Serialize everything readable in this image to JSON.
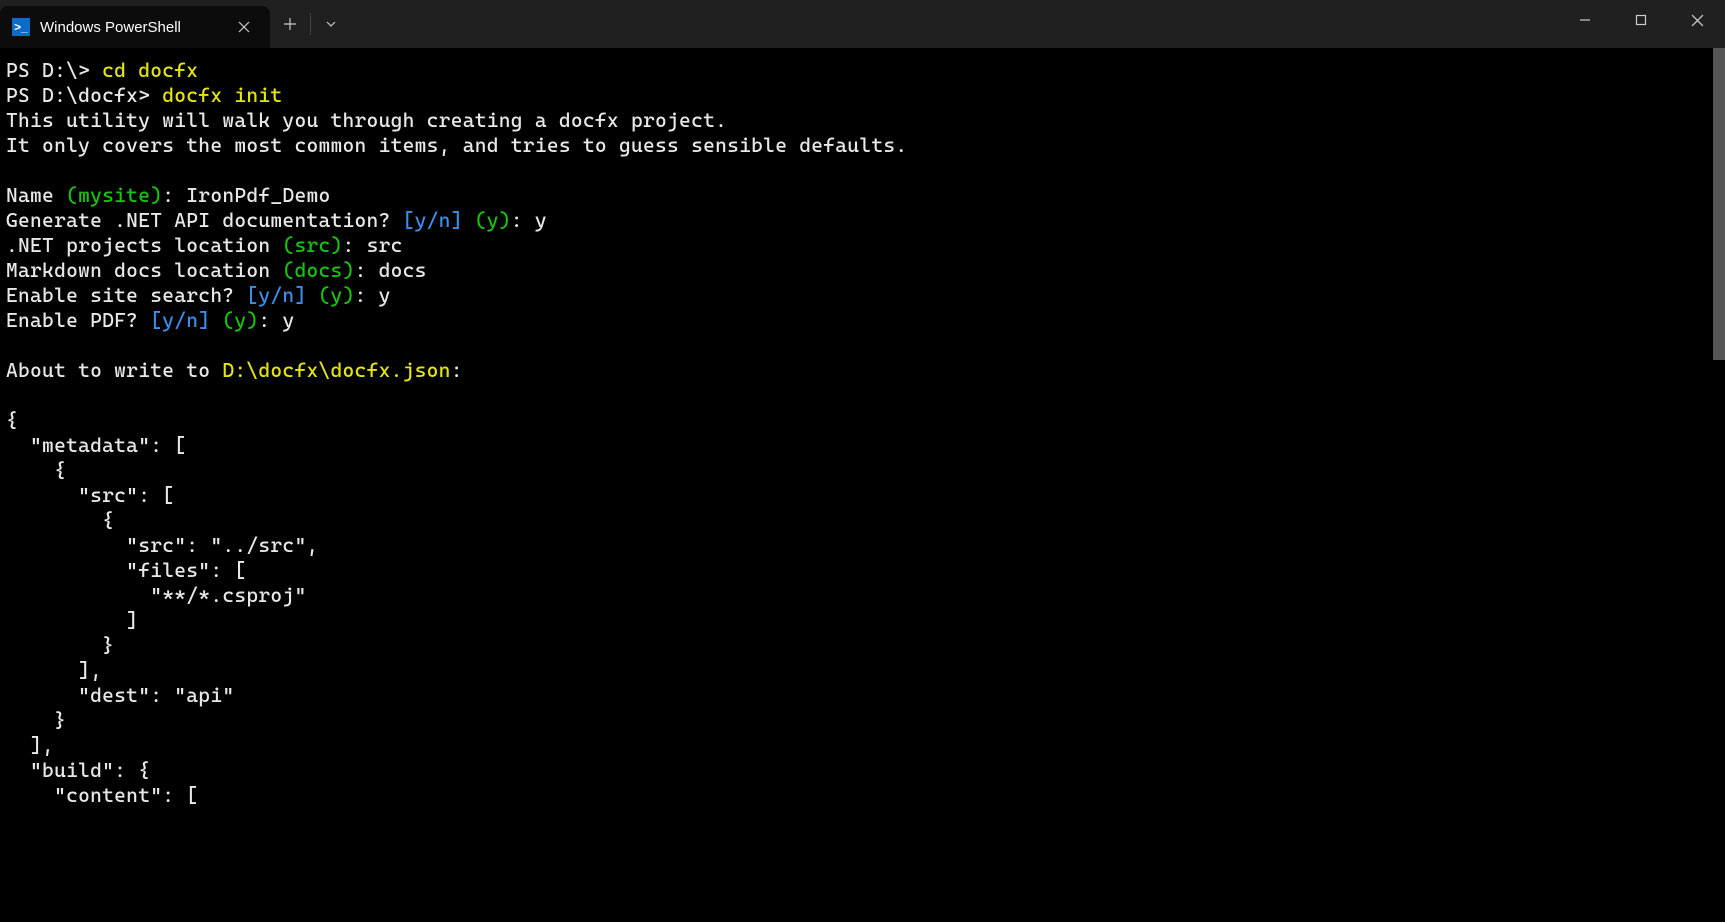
{
  "tab": {
    "title": "Windows PowerShell"
  },
  "terminal": {
    "line1_prompt": "PS D:\\> ",
    "line1_cmd": "cd docfx",
    "line2_prompt": "PS D:\\docfx> ",
    "line2_cmd": "docfx init",
    "line3": "This utility will walk you through creating a docfx project.",
    "line4": "It only covers the most common items, and tries to guess sensible defaults.",
    "line5_a": "Name ",
    "line5_b": "(mysite)",
    "line5_c": ": IronPdf_Demo",
    "line6_a": "Generate .NET API documentation? ",
    "line6_b": "[y/n]",
    "line6_c": " (y)",
    "line6_d": ": y",
    "line7_a": ".NET projects location ",
    "line7_b": "(src)",
    "line7_c": ": src",
    "line8_a": "Markdown docs location ",
    "line8_b": "(docs)",
    "line8_c": ": docs",
    "line9_a": "Enable site search? ",
    "line9_b": "[y/n]",
    "line9_c": " (y)",
    "line9_d": ": y",
    "line10_a": "Enable PDF? ",
    "line10_b": "[y/n]",
    "line10_c": " (y)",
    "line10_d": ": y",
    "line11_a": "About to write to ",
    "line11_b": "D:\\docfx\\docfx.json",
    "line11_c": ":",
    "json_l1": "{",
    "json_l2": "  \"metadata\": [",
    "json_l3": "    {",
    "json_l4": "      \"src\": [",
    "json_l5": "        {",
    "json_l6": "          \"src\": \"../src\",",
    "json_l7": "          \"files\": [",
    "json_l8": "            \"**/*.csproj\"",
    "json_l9": "          ]",
    "json_l10": "        }",
    "json_l11": "      ],",
    "json_l12": "      \"dest\": \"api\"",
    "json_l13": "    }",
    "json_l14": "  ],",
    "json_l15": "  \"build\": {",
    "json_l16": "    \"content\": ["
  }
}
